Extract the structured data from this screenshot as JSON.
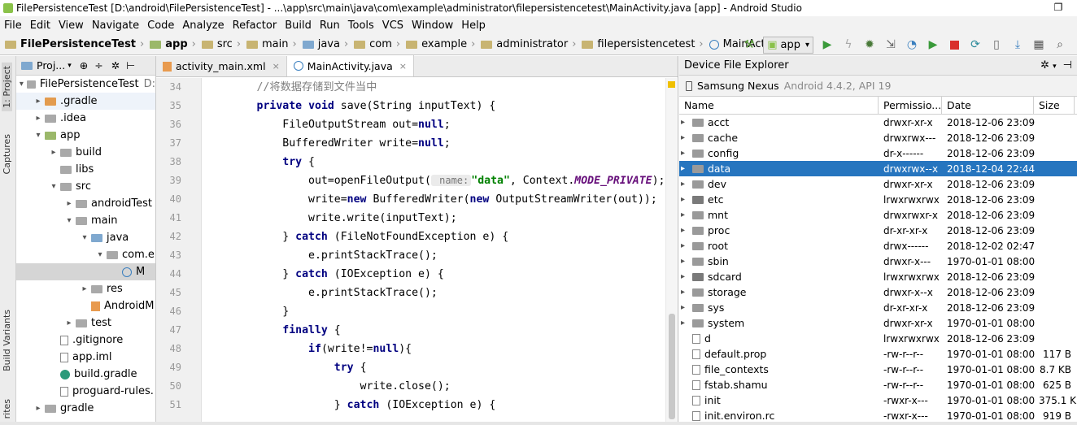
{
  "window": {
    "title": "FilePersistenceTest [D:\\android\\FilePersistenceTest] - ...\\app\\src\\main\\java\\com\\example\\administrator\\filepersistencetest\\MainActivity.java [app] - Android Studio",
    "restore": "❐"
  },
  "menu": [
    "File",
    "Edit",
    "View",
    "Navigate",
    "Code",
    "Analyze",
    "Refactor",
    "Build",
    "Run",
    "Tools",
    "VCS",
    "Window",
    "Help"
  ],
  "breadcrumb": [
    "FilePersistenceTest",
    "app",
    "src",
    "main",
    "java",
    "com",
    "example",
    "administrator",
    "filepersistencetest",
    "MainActivity"
  ],
  "toolbar": {
    "run_config": "app"
  },
  "left_strip": {
    "project_tab": "1: Project",
    "captures_tab": "Captures",
    "build_variants_tab": "Build Variants",
    "favorites_tab": "rites"
  },
  "project_panel": {
    "header": "Proj...",
    "tree": [
      {
        "label": "FilePersistenceTest",
        "suffix": "D:",
        "indent": 0,
        "arrow": "▾",
        "icon": "gray"
      },
      {
        "label": ".gradle",
        "indent": 1,
        "arrow": "▸",
        "icon": "orange",
        "sel_light": true
      },
      {
        "label": ".idea",
        "indent": 1,
        "arrow": "▸",
        "icon": "gray"
      },
      {
        "label": "app",
        "indent": 1,
        "arrow": "▾",
        "icon": "green"
      },
      {
        "label": "build",
        "indent": 2,
        "arrow": "▸",
        "icon": "gray"
      },
      {
        "label": "libs",
        "indent": 2,
        "arrow": "",
        "icon": "gray"
      },
      {
        "label": "src",
        "indent": 2,
        "arrow": "▾",
        "icon": "gray"
      },
      {
        "label": "androidTest",
        "indent": 3,
        "arrow": "▸",
        "icon": "gray"
      },
      {
        "label": "main",
        "indent": 3,
        "arrow": "▾",
        "icon": "gray"
      },
      {
        "label": "java",
        "indent": 4,
        "arrow": "▾",
        "icon": "blue"
      },
      {
        "label": "com.e",
        "indent": 5,
        "arrow": "▾",
        "icon": "gray"
      },
      {
        "label": "M",
        "indent": 6,
        "arrow": "",
        "icon": "class",
        "selected": true
      },
      {
        "label": "res",
        "indent": 4,
        "arrow": "▸",
        "icon": "gray"
      },
      {
        "label": "AndroidM",
        "indent": 4,
        "arrow": "",
        "icon": "xml"
      },
      {
        "label": "test",
        "indent": 3,
        "arrow": "▸",
        "icon": "gray"
      },
      {
        "label": ".gitignore",
        "indent": 2,
        "arrow": "",
        "icon": "file"
      },
      {
        "label": "app.iml",
        "indent": 2,
        "arrow": "",
        "icon": "file"
      },
      {
        "label": "build.gradle",
        "indent": 2,
        "arrow": "",
        "icon": "gradle"
      },
      {
        "label": "proguard-rules.",
        "indent": 2,
        "arrow": "",
        "icon": "file"
      },
      {
        "label": "gradle",
        "indent": 1,
        "arrow": "▸",
        "icon": "gray"
      }
    ]
  },
  "editor": {
    "tabs": [
      {
        "label": "activity_main.xml",
        "active": false
      },
      {
        "label": "MainActivity.java",
        "active": true
      }
    ],
    "line_numbers": [
      "34",
      "35",
      "36",
      "37",
      "38",
      "39",
      "40",
      "41",
      "42",
      "43",
      "44",
      "45",
      "46",
      "47",
      "48",
      "49",
      "50",
      "51"
    ],
    "code": [
      "        //将数据存储到文件当中",
      "        private void save(String inputText) {",
      "            FileOutputStream out=null;",
      "            BufferedWriter write=null;",
      "            try {",
      "                out=openFileOutput( name: \"data\", Context.MODE_PRIVATE);",
      "                write=new BufferedWriter(new OutputStreamWriter(out));",
      "                write.write(inputText);",
      "            } catch (FileNotFoundException e) {",
      "                e.printStackTrace();",
      "            } catch (IOException e) {",
      "                e.printStackTrace();",
      "            }",
      "            finally {",
      "                if(write!=null){",
      "                    try {",
      "                        write.close();",
      "                    } catch (IOException e) {"
    ]
  },
  "device_explorer": {
    "title": "Device File Explorer",
    "device": "Samsung Nexus",
    "device_detail": "Android 4.4.2, API 19",
    "columns": [
      "Name",
      "Permissio...",
      "Date",
      "Size"
    ],
    "rows": [
      {
        "name": "acct",
        "perm": "drwxr-xr-x",
        "date": "2018-12-06 23:09",
        "size": "",
        "type": "dir"
      },
      {
        "name": "cache",
        "perm": "drwxrwx---",
        "date": "2018-12-06 23:09",
        "size": "",
        "type": "dir"
      },
      {
        "name": "config",
        "perm": "dr-x------",
        "date": "2018-12-06 23:09",
        "size": "",
        "type": "dir"
      },
      {
        "name": "data",
        "perm": "drwxrwx--x",
        "date": "2018-12-04 22:44",
        "size": "",
        "type": "dir",
        "selected": true
      },
      {
        "name": "dev",
        "perm": "drwxr-xr-x",
        "date": "2018-12-06 23:09",
        "size": "",
        "type": "dir"
      },
      {
        "name": "etc",
        "perm": "lrwxrwxrwx",
        "date": "2018-12-06 23:09",
        "size": "",
        "type": "link"
      },
      {
        "name": "mnt",
        "perm": "drwxrwxr-x",
        "date": "2018-12-06 23:09",
        "size": "",
        "type": "dir"
      },
      {
        "name": "proc",
        "perm": "dr-xr-xr-x",
        "date": "2018-12-06 23:09",
        "size": "",
        "type": "dir"
      },
      {
        "name": "root",
        "perm": "drwx------",
        "date": "2018-12-02 02:47",
        "size": "",
        "type": "dir"
      },
      {
        "name": "sbin",
        "perm": "drwxr-x---",
        "date": "1970-01-01 08:00",
        "size": "",
        "type": "dir"
      },
      {
        "name": "sdcard",
        "perm": "lrwxrwxrwx",
        "date": "2018-12-06 23:09",
        "size": "",
        "type": "link"
      },
      {
        "name": "storage",
        "perm": "drwxr-x--x",
        "date": "2018-12-06 23:09",
        "size": "",
        "type": "dir"
      },
      {
        "name": "sys",
        "perm": "dr-xr-xr-x",
        "date": "2018-12-06 23:09",
        "size": "",
        "type": "dir"
      },
      {
        "name": "system",
        "perm": "drwxr-xr-x",
        "date": "1970-01-01 08:00",
        "size": "",
        "type": "dir"
      },
      {
        "name": "d",
        "perm": "lrwxrwxrwx",
        "date": "2018-12-06 23:09",
        "size": "",
        "type": "linkfile"
      },
      {
        "name": "default.prop",
        "perm": "-rw-r--r--",
        "date": "1970-01-01 08:00",
        "size": "117 B",
        "type": "file"
      },
      {
        "name": "file_contexts",
        "perm": "-rw-r--r--",
        "date": "1970-01-01 08:00",
        "size": "8.7 KB",
        "type": "file"
      },
      {
        "name": "fstab.shamu",
        "perm": "-rw-r--r--",
        "date": "1970-01-01 08:00",
        "size": "625 B",
        "type": "file"
      },
      {
        "name": "init",
        "perm": "-rwxr-x---",
        "date": "1970-01-01 08:00",
        "size": "375.1 K",
        "type": "file"
      },
      {
        "name": "init.environ.rc",
        "perm": "-rwxr-x---",
        "date": "1970-01-01 08:00",
        "size": "919 B",
        "type": "file"
      }
    ]
  }
}
